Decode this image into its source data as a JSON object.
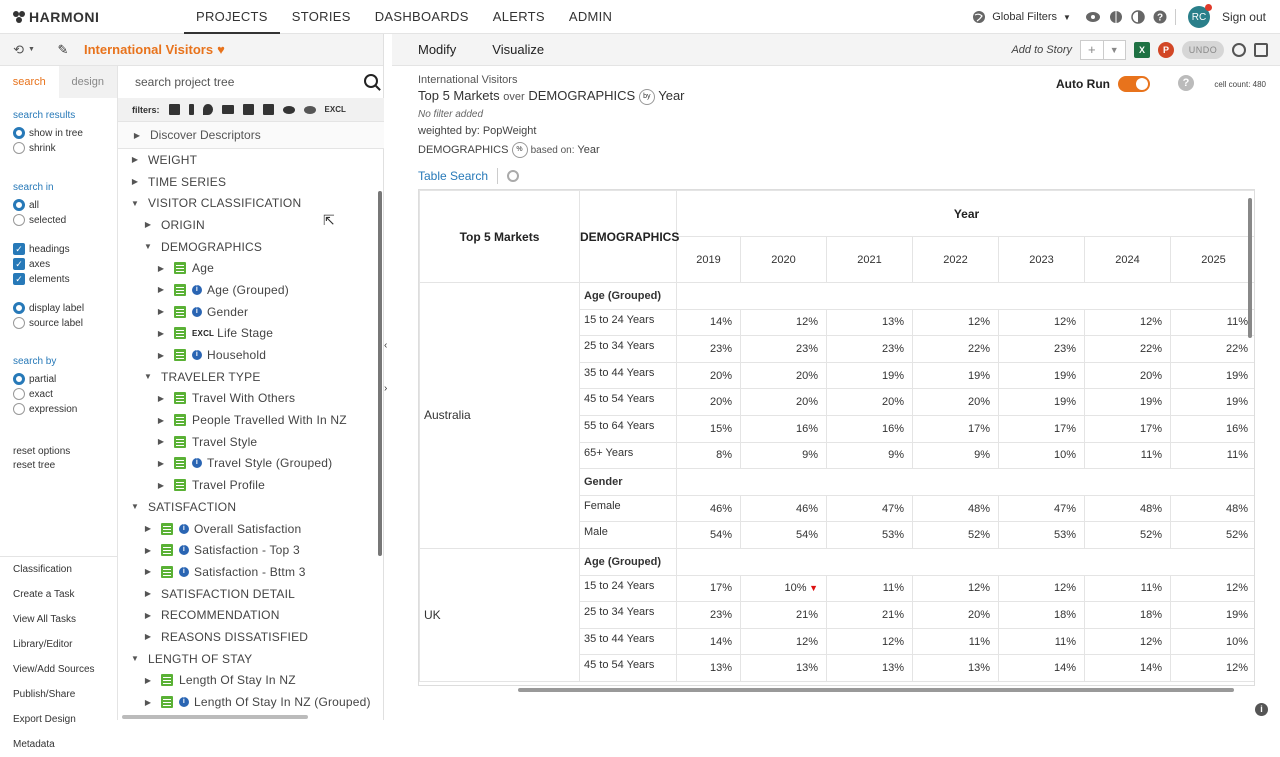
{
  "app": {
    "logo": "HARMONI",
    "nav": [
      "PROJECTS",
      "STORIES",
      "DASHBOARDS",
      "ALERTS",
      "ADMIN"
    ],
    "active_nav": "PROJECTS",
    "global_filters": "Global Filters",
    "avatar_initials": "RC",
    "sign_out": "Sign out"
  },
  "project": {
    "name": "International Visitors"
  },
  "options": {
    "tabs": [
      "search",
      "design"
    ],
    "search_results_heading": "search results",
    "search_results": [
      "show in tree",
      "shrink"
    ],
    "search_in_heading": "search in",
    "search_in": [
      "all",
      "selected"
    ],
    "search_in_checks": [
      "headings",
      "axes",
      "elements"
    ],
    "label_options": [
      "display label",
      "source label"
    ],
    "search_by_heading": "search by",
    "search_by": [
      "partial",
      "exact",
      "expression"
    ],
    "reset_options": "reset options",
    "reset_tree": "reset tree",
    "links": [
      "Classification",
      "Create a Task",
      "View All Tasks",
      "Library/Editor",
      "View/Add Sources",
      "Publish/Share",
      "Export Design",
      "Metadata"
    ]
  },
  "tree": {
    "search_placeholder": "search project tree",
    "filters_label": "filters:",
    "excl_label": "EXCL",
    "discover": "Discover Descriptors",
    "nodes": [
      {
        "label": "WEIGHT",
        "level": 0,
        "caret": "right"
      },
      {
        "label": "TIME SERIES",
        "level": 0,
        "caret": "right"
      },
      {
        "label": "VISITOR CLASSIFICATION",
        "level": 0,
        "caret": "down"
      },
      {
        "label": "ORIGIN",
        "level": 1,
        "caret": "right"
      },
      {
        "label": "DEMOGRAPHICS",
        "level": 1,
        "caret": "down"
      },
      {
        "label": "Age",
        "level": 2,
        "caret": "right",
        "var": true
      },
      {
        "label": "Age (Grouped)",
        "level": 2,
        "caret": "right",
        "var": true,
        "info": true
      },
      {
        "label": "Gender",
        "level": 2,
        "caret": "right",
        "var": true,
        "info": true
      },
      {
        "label": "Life Stage",
        "level": 2,
        "caret": "right",
        "var": true,
        "excl": true
      },
      {
        "label": "Household",
        "level": 2,
        "caret": "right",
        "var": true,
        "info": true
      },
      {
        "label": "TRAVELER TYPE",
        "level": 1,
        "caret": "down"
      },
      {
        "label": "Travel With Others",
        "level": 2,
        "caret": "right",
        "var": true
      },
      {
        "label": "People Travelled With In NZ",
        "level": 2,
        "caret": "right",
        "var": true
      },
      {
        "label": "Travel Style",
        "level": 2,
        "caret": "right",
        "var": true
      },
      {
        "label": "Travel Style (Grouped)",
        "level": 2,
        "caret": "right",
        "var": true,
        "info": true
      },
      {
        "label": "Travel Profile",
        "level": 2,
        "caret": "right",
        "var": true
      },
      {
        "label": "SATISFACTION",
        "level": 0,
        "caret": "down"
      },
      {
        "label": "Overall Satisfaction",
        "level": 1,
        "caret": "right",
        "var": true,
        "info": true
      },
      {
        "label": "Satisfaction - Top 3",
        "level": 1,
        "caret": "right",
        "var": true,
        "info": true
      },
      {
        "label": "Satisfaction - Bttm 3",
        "level": 1,
        "caret": "right",
        "var": true,
        "info": true
      },
      {
        "label": "SATISFACTION DETAIL",
        "level": 1,
        "caret": "right"
      },
      {
        "label": "RECOMMENDATION",
        "level": 1,
        "caret": "right"
      },
      {
        "label": "REASONS DISSATISFIED",
        "level": 1,
        "caret": "right"
      },
      {
        "label": "LENGTH OF STAY",
        "level": 0,
        "caret": "down"
      },
      {
        "label": "Length Of Stay In NZ",
        "level": 1,
        "caret": "right",
        "var": true
      },
      {
        "label": "Length Of Stay In NZ (Grouped)",
        "level": 1,
        "caret": "right",
        "var": true,
        "info": true
      }
    ]
  },
  "toolbar": {
    "tabs": [
      "Modify",
      "Visualize"
    ],
    "add_to_story": "Add to Story",
    "undo": "UNDO"
  },
  "report": {
    "project": "International Visitors",
    "rows_label": "Top 5 Markets",
    "over": "over",
    "cols_label": "DEMOGRAPHICS",
    "by": "by",
    "by_label": "Year",
    "no_filter": "No filter added",
    "weighted_prefix": "weighted by:",
    "weighted_by": "PopWeight",
    "based_prefix": "DEMOGRAPHICS",
    "pct": "%",
    "based_on_text": "based on:",
    "based_on": "Year",
    "table_search": "Table Search",
    "auto_run": "Auto Run",
    "cell_count": "cell count: 480"
  },
  "table": {
    "h_markets": "Top 5 Markets",
    "h_demo": "DEMOGRAPHICS",
    "h_year": "Year",
    "years": [
      "2019",
      "2020",
      "2021",
      "2022",
      "2023",
      "2024",
      "2025"
    ],
    "markets": [
      {
        "name": "Australia",
        "groups": [
          {
            "name": "Age (Grouped)",
            "rows": [
              {
                "label": "15 to 24 Years",
                "values": [
                  "14%",
                  "12%",
                  "13%",
                  "12%",
                  "12%",
                  "12%",
                  "11%"
                ]
              },
              {
                "label": "25 to 34 Years",
                "values": [
                  "23%",
                  "23%",
                  "23%",
                  "22%",
                  "23%",
                  "22%",
                  "22%"
                ]
              },
              {
                "label": "35 to 44 Years",
                "values": [
                  "20%",
                  "20%",
                  "19%",
                  "19%",
                  "19%",
                  "20%",
                  "19%"
                ]
              },
              {
                "label": "45 to 54 Years",
                "values": [
                  "20%",
                  "20%",
                  "20%",
                  "20%",
                  "19%",
                  "19%",
                  "19%"
                ]
              },
              {
                "label": "55 to 64 Years",
                "values": [
                  "15%",
                  "16%",
                  "16%",
                  "17%",
                  "17%",
                  "17%",
                  "16%"
                ]
              },
              {
                "label": "65+ Years",
                "values": [
                  "8%",
                  "9%",
                  "9%",
                  "9%",
                  "10%",
                  "11%",
                  "11%"
                ]
              }
            ]
          },
          {
            "name": "Gender",
            "rows": [
              {
                "label": "Female",
                "values": [
                  "46%",
                  "46%",
                  "47%",
                  "48%",
                  "47%",
                  "48%",
                  "48%"
                ]
              },
              {
                "label": "Male",
                "values": [
                  "54%",
                  "54%",
                  "53%",
                  "52%",
                  "53%",
                  "52%",
                  "52%"
                ]
              }
            ]
          }
        ]
      },
      {
        "name": "UK",
        "groups": [
          {
            "name": "Age (Grouped)",
            "rows": [
              {
                "label": "15 to 24 Years",
                "values": [
                  "17%",
                  "10%",
                  "11%",
                  "12%",
                  "12%",
                  "11%",
                  "12%"
                ],
                "down": [
                  1
                ]
              },
              {
                "label": "25 to 34 Years",
                "values": [
                  "23%",
                  "21%",
                  "21%",
                  "20%",
                  "18%",
                  "18%",
                  "19%"
                ]
              },
              {
                "label": "35 to 44 Years",
                "values": [
                  "14%",
                  "12%",
                  "12%",
                  "11%",
                  "11%",
                  "12%",
                  "10%"
                ]
              },
              {
                "label": "45 to 54 Years",
                "values": [
                  "13%",
                  "13%",
                  "13%",
                  "13%",
                  "14%",
                  "14%",
                  "12%"
                ]
              }
            ]
          }
        ]
      }
    ]
  }
}
